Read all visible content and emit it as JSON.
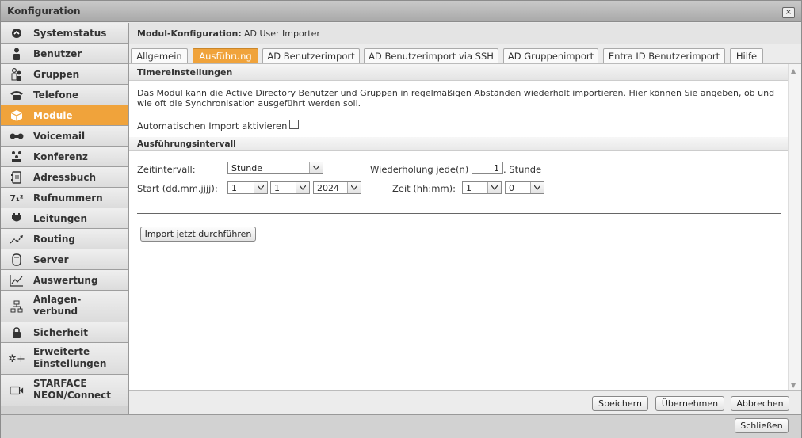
{
  "window": {
    "title": "Konfiguration",
    "close_glyph": "×"
  },
  "sidebar": {
    "items": [
      {
        "label": "Systemstatus",
        "icon": "status-icon"
      },
      {
        "label": "Benutzer",
        "icon": "user-icon"
      },
      {
        "label": "Gruppen",
        "icon": "group-icon"
      },
      {
        "label": "Telefone",
        "icon": "phone-icon"
      },
      {
        "label": "Module",
        "icon": "module-icon",
        "active": true
      },
      {
        "label": "Voicemail",
        "icon": "voicemail-icon"
      },
      {
        "label": "Konferenz",
        "icon": "conference-icon"
      },
      {
        "label": "Adressbuch",
        "icon": "addressbook-icon"
      },
      {
        "label": "Rufnummern",
        "icon": "number-icon",
        "icon_text": "7₁²"
      },
      {
        "label": "Leitungen",
        "icon": "line-icon"
      },
      {
        "label": "Routing",
        "icon": "routing-icon"
      },
      {
        "label": "Server",
        "icon": "server-icon"
      },
      {
        "label": "Auswertung",
        "icon": "chart-icon"
      },
      {
        "label": "Anlagen-",
        "label2": "verbund",
        "icon": "network-icon"
      },
      {
        "label": "Sicherheit",
        "icon": "lock-icon"
      },
      {
        "label": "Erweiterte",
        "label2": "Einstellungen",
        "icon": "advanced-settings-icon",
        "icon_text": "✲+"
      },
      {
        "label": "STARFACE",
        "label2": "NEON/Connect",
        "icon": "video-icon"
      }
    ]
  },
  "module": {
    "header_label": "Modul-Konfiguration:",
    "header_value": "AD User Importer"
  },
  "tabs": [
    {
      "label": "Allgemein"
    },
    {
      "label": "Ausführung",
      "active": true
    },
    {
      "label": "AD Benutzerimport"
    },
    {
      "label": "AD Benutzerimport via SSH"
    },
    {
      "label": "AD Gruppenimport"
    },
    {
      "label": "Entra ID Benutzerimport"
    },
    {
      "label": "Hilfe"
    }
  ],
  "timer": {
    "section_title": "Timereinstellungen",
    "description_line1": "Das Modul kann die Active Directory Benutzer und Gruppen in regelmäßigen Abständen wiederholt importieren. Hier können Sie angeben, ob und",
    "description_line2": "wie oft die Synchronisation ausgeführt werden soll.",
    "auto_import_label": "Automatischen Import aktivieren"
  },
  "interval": {
    "section_title": "Ausführungsintervall",
    "zeitintervall_label": "Zeitintervall:",
    "zeitintervall_value": "Stunde",
    "wiederholung_label": "Wiederholung jede(n)",
    "wiederholung_value": "1",
    "wiederholung_suffix": ". Stunde",
    "start_label": "Start (dd.mm.jjjj):",
    "start_day": "1",
    "start_month": "1",
    "start_year": "2024",
    "zeit_label": "Zeit (hh:mm):",
    "zeit_hour": "1",
    "zeit_minute": "0",
    "import_now_label": "Import jetzt durchführen"
  },
  "footer": {
    "save": "Speichern",
    "apply": "Übernehmen",
    "cancel": "Abbrechen"
  },
  "bottom": {
    "close": "Schließen"
  }
}
